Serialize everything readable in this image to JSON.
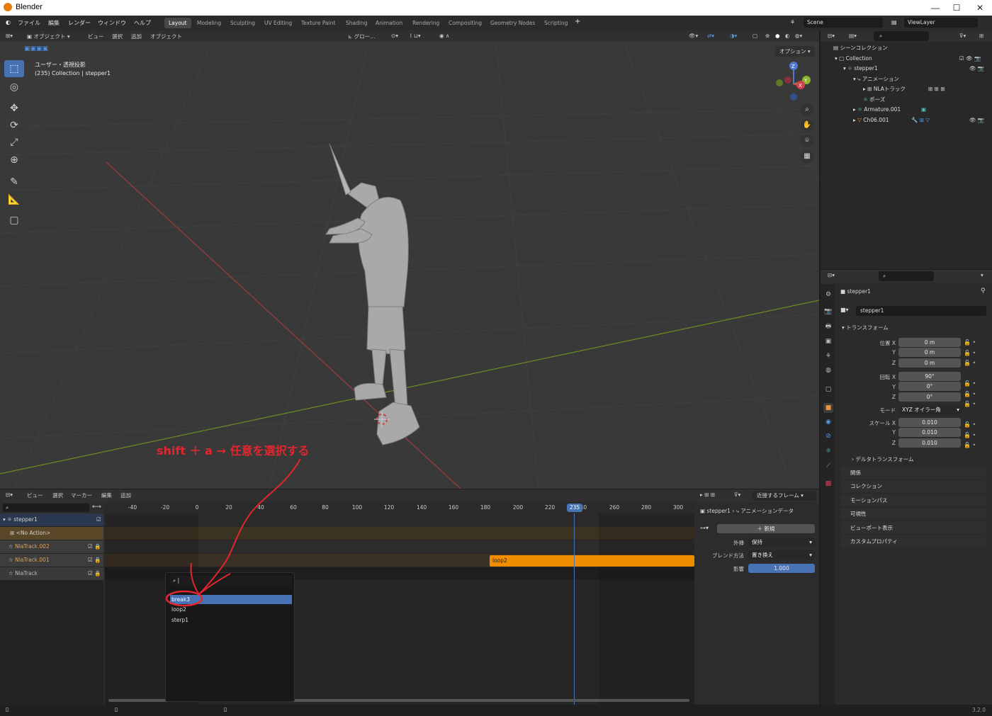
{
  "window": {
    "title": "Blender",
    "min": "—",
    "max": "☐",
    "close": "✕"
  },
  "menu": [
    "ファイル",
    "編集",
    "レンダー",
    "ウィンドウ",
    "ヘルプ"
  ],
  "workspaces": [
    "Layout",
    "Modeling",
    "Sculpting",
    "UV Editing",
    "Texture Paint",
    "Shading",
    "Animation",
    "Rendering",
    "Compositing",
    "Geometry Nodes",
    "Scripting"
  ],
  "workspace_add": "+",
  "scene": "Scene",
  "viewlayer": "ViewLayer",
  "viewport": {
    "mode": "オブジェクト",
    "menus": [
      "ビュー",
      "選択",
      "追加",
      "オブジェクト"
    ],
    "transform_orient": "グロー...",
    "options": "オプション",
    "overlay_title": "ユーザー・透視投影",
    "overlay_sub": "(235) Collection | stepper1",
    "axes": {
      "z": "Z",
      "y": "Y",
      "x": "X"
    }
  },
  "outliner": {
    "scene_collection": "シーンコレクション",
    "collection": "Collection",
    "object": "stepper1",
    "animation": "アニメーション",
    "nla": "NLAトラック",
    "pose": "ポーズ",
    "armature": "Armature.001",
    "mesh": "Ch06.001"
  },
  "properties": {
    "header_name": "stepper1",
    "object_field": "stepper1",
    "transform": "トランスフォーム",
    "location_label": "位置 X",
    "rotation_label": "回転 X",
    "scale_label": "スケール X",
    "y": "Y",
    "z": "Z",
    "loc": [
      "0 m",
      "0 m",
      "0 m"
    ],
    "rot": [
      "90°",
      "0°",
      "0°"
    ],
    "mode_label": "モード",
    "mode": "XYZ オイラー角",
    "scale": [
      "0.010",
      "0.010",
      "0.010"
    ],
    "delta": "デルタトランスフォーム",
    "panels": [
      "関係",
      "コレクション",
      "モーションパス",
      "可視性",
      "ビューポート表示",
      "カスタムプロパティ"
    ]
  },
  "nla": {
    "menus": [
      "ビュー",
      "選択",
      "マーカー",
      "編集",
      "追加"
    ],
    "snap": "近接するフレーム",
    "ticks": [
      "-40",
      "-20",
      "0",
      "20",
      "40",
      "60",
      "80",
      "100",
      "120",
      "140",
      "160",
      "180",
      "200",
      "220",
      "240",
      "260",
      "280",
      "300"
    ],
    "current_frame": "235",
    "tracks": [
      {
        "name": "stepper1",
        "color": "#e0e0e0"
      },
      {
        "name": "<No Action>",
        "color": "#e0e0e0"
      },
      {
        "name": "NlaTrack.002",
        "color": "#e8a040"
      },
      {
        "name": "NlaTrack.001",
        "color": "#e8a040"
      },
      {
        "name": "NlaTrack",
        "color": "#bbbbbb"
      }
    ],
    "strip": "loop2",
    "side": {
      "breadcrumb1": "stepper1",
      "breadcrumb2": "アニメーションデータ",
      "new": "新規",
      "extrapolation_label": "外挿",
      "extrapolation": "保持",
      "blend_label": "ブレンド方法",
      "blend": "置き換え",
      "influence_label": "影響",
      "influence": "1.000"
    }
  },
  "popup": {
    "items": [
      "break3",
      "loop2",
      "sterp1"
    ]
  },
  "annotation": "shift ＋ a → 任意を選択する",
  "version": "3.2.0"
}
